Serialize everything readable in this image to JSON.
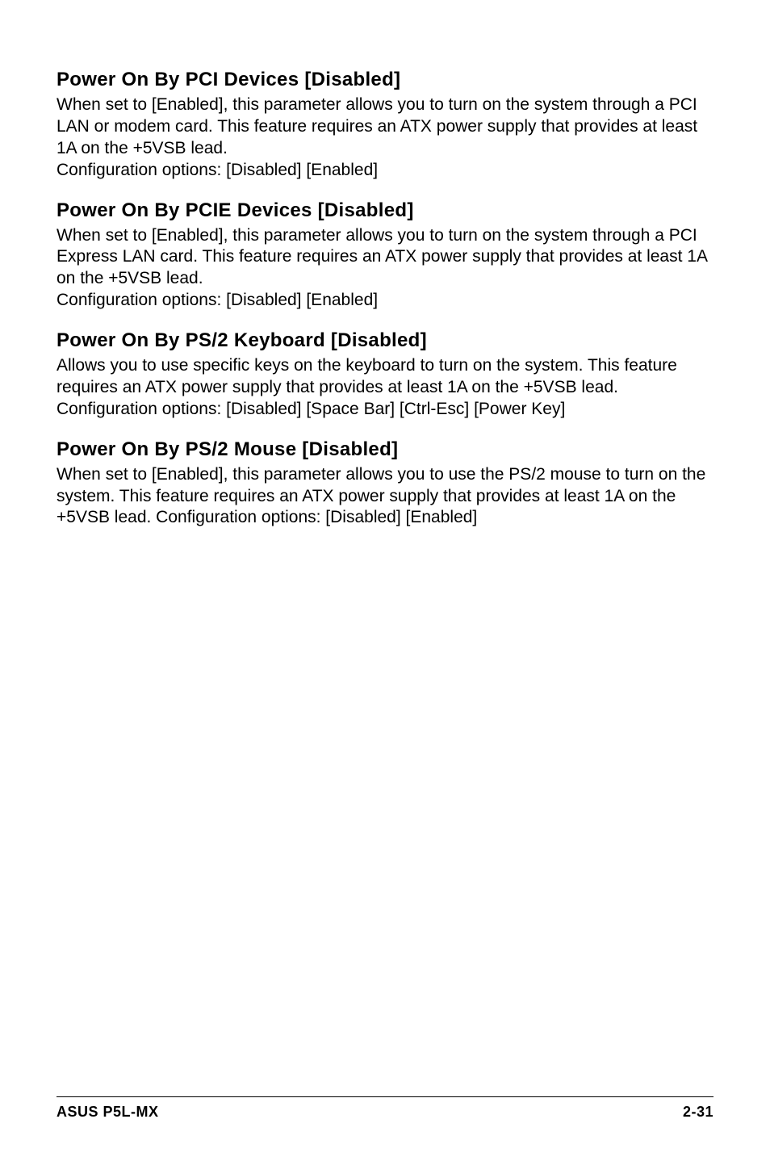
{
  "sections": [
    {
      "heading": "Power On By PCI Devices [Disabled]",
      "body": "When set to [Enabled], this parameter allows you to turn on the system through a PCI LAN or modem card. This feature requires an ATX power supply that provides at least 1A on the +5VSB lead.\nConfiguration options: [Disabled] [Enabled]"
    },
    {
      "heading": "Power On By PCIE Devices [Disabled]",
      "body": "When set to [Enabled], this parameter allows you to turn on the system through a PCI Express LAN card. This feature requires an ATX power supply that provides at least 1A on the +5VSB lead.\nConfiguration options: [Disabled] [Enabled]"
    },
    {
      "heading": "Power On By PS/2 Keyboard [Disabled]",
      "body": "Allows you to use specific keys on the keyboard to turn on the system. This feature requires an ATX power supply that provides at least 1A on the +5VSB lead. Configuration options: [Disabled] [Space Bar] [Ctrl-Esc] [Power Key]"
    },
    {
      "heading": "Power On By PS/2 Mouse [Disabled]",
      "body": "When set to [Enabled], this parameter allows you to use the PS/2 mouse to turn on the system. This feature requires an ATX power supply that provides at least 1A on the +5VSB lead. Configuration options: [Disabled] [Enabled]"
    }
  ],
  "footer": {
    "left": "ASUS P5L-MX",
    "right": "2-31"
  }
}
